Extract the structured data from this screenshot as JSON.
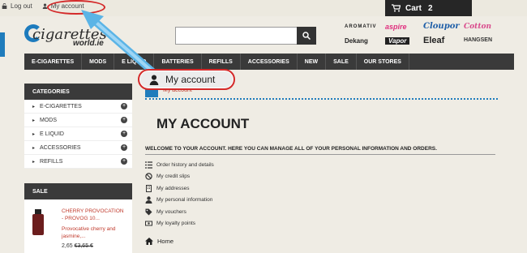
{
  "topbar": {
    "logout": "Log out",
    "my_account": "My account"
  },
  "cart": {
    "label": "Cart",
    "count": "2"
  },
  "logo": {
    "line1": "cigarettes",
    "line2": "world.ie"
  },
  "search": {
    "placeholder": ""
  },
  "brands": [
    "AROMATIV",
    "aspire",
    "Cloupor",
    "Cotton",
    "Dekang",
    "Eleaf",
    "HANGSEN",
    "Vapor"
  ],
  "nav": [
    "E-CIGARETTES",
    "MODS",
    "E LIQUID",
    "BATTERIES",
    "REFILLS",
    "ACCESSORIES",
    "NEW",
    "SALE",
    "OUR STORES"
  ],
  "sidebar": {
    "categories_title": "CATEGORIES",
    "categories": [
      "E-CIGARETTES",
      "MODS",
      "E LIQUID",
      "ACCESSORIES",
      "REFILLS"
    ],
    "sale_title": "SALE",
    "sale_item": {
      "title": "CHERRY PROVOCATION - PROVOG 10...",
      "desc": "Provocative cherry and jasmine,...",
      "price": "2,65",
      "old_price": "€3,65 €"
    }
  },
  "breadcrumb": {
    "current": "My account"
  },
  "page": {
    "title": "MY ACCOUNT",
    "welcome": "WELCOME TO YOUR ACCOUNT. HERE YOU CAN MANAGE ALL OF YOUR PERSONAL INFORMATION AND ORDERS.",
    "links": [
      "Order history and details",
      "My credit slips",
      "My addresses",
      "My personal information",
      "My vouchers",
      "My loyalty points"
    ],
    "home": "Home"
  },
  "callout": {
    "label": "My account"
  },
  "colors": {
    "accent": "#1f7cbc",
    "highlight": "#d42a2a",
    "dark_bar": "#3a3a3a"
  }
}
